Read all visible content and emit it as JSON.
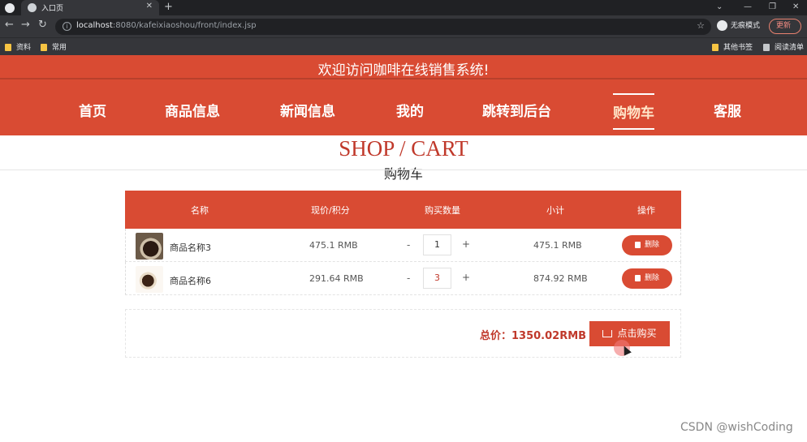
{
  "browser": {
    "tab_title": "入口页",
    "url_host": "localhost",
    "url_rest": ":8080/kafeixiaoshou/front/index.jsp",
    "incognito_label": "无痕模式",
    "update_label": "更新",
    "bookmarks": [
      "资料",
      "常用"
    ],
    "bookmarks_right": [
      "其他书签",
      "阅读清单"
    ]
  },
  "site": {
    "banner": "欢迎访问咖啡在线销售系统!",
    "nav": [
      "首页",
      "商品信息",
      "新闻信息",
      "我的",
      "跳转到后台",
      "购物车",
      "客服"
    ],
    "active_nav": "购物车"
  },
  "page": {
    "title_en": "SHOP / CART",
    "title_cn": "购物车"
  },
  "cart": {
    "columns": [
      "名称",
      "现价/积分",
      "购买数量",
      "小计",
      "操作"
    ],
    "rows": [
      {
        "name": "商品名称3",
        "price": "475.1 RMB",
        "qty": "1",
        "subtotal": "475.1 RMB",
        "delete": "删除"
      },
      {
        "name": "商品名称6",
        "price": "291.64 RMB",
        "qty": "3",
        "subtotal": "874.92 RMB",
        "delete": "删除"
      }
    ],
    "minus_label": "-",
    "plus_label": "+",
    "total": "总价：1350.02RMB",
    "buy_label": "点击购买"
  },
  "watermark": "CSDN @wishCoding",
  "colors": {
    "accent": "#d94b33",
    "total": "#c0392b"
  }
}
